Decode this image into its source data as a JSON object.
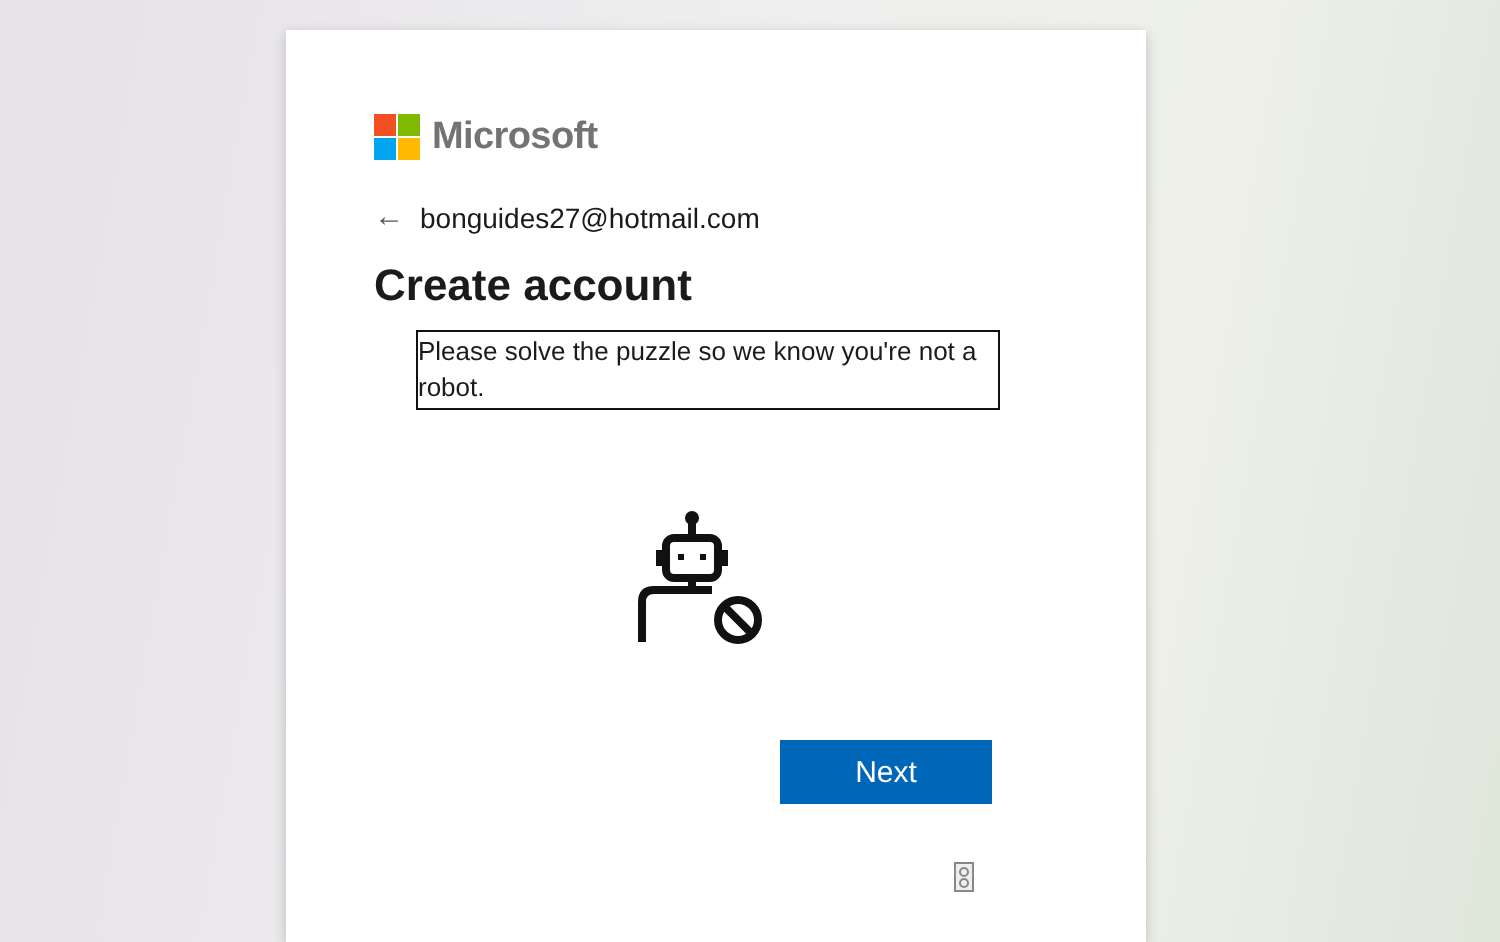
{
  "brand": {
    "name": "Microsoft"
  },
  "back": {
    "arrow": "←",
    "email": "bonguides27@hotmail.com"
  },
  "title": "Create account",
  "message": "Please solve the puzzle so we know you're not a robot.",
  "buttons": [
    {
      "label": "Next"
    }
  ]
}
